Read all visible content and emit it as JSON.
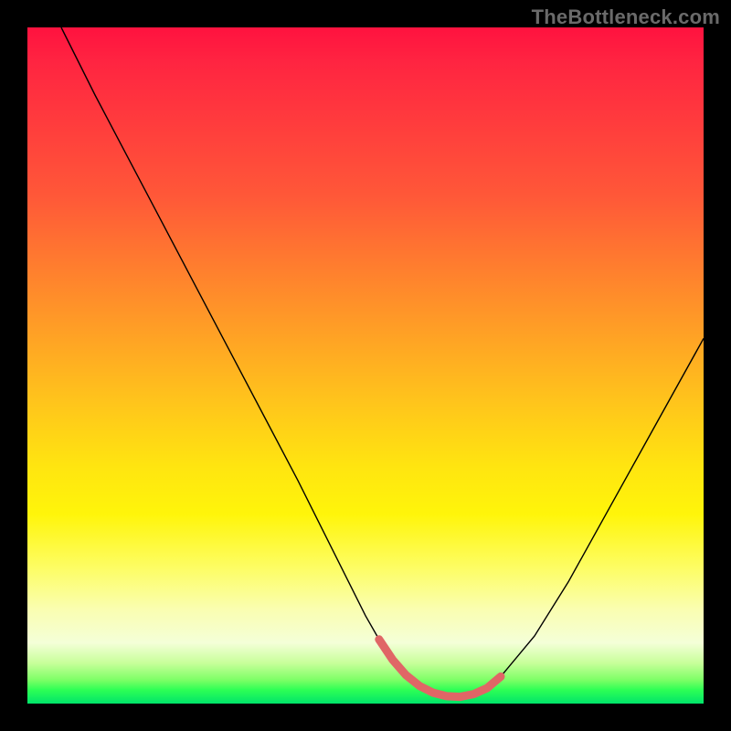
{
  "watermark": "TheBottleneck.com",
  "chart_data": {
    "type": "line",
    "title": "",
    "xlabel": "",
    "ylabel": "",
    "xlim": [
      0,
      100
    ],
    "ylim": [
      0,
      100
    ],
    "grid": false,
    "legend": false,
    "background_gradient": [
      "#ff123f",
      "#ff8e2a",
      "#ffe510",
      "#fafeb0",
      "#2dff55",
      "#00e36a"
    ],
    "series": [
      {
        "name": "bottleneck-curve",
        "color": "#000000",
        "stroke_width": 1.4,
        "x": [
          5,
          10,
          15,
          20,
          25,
          30,
          35,
          40,
          45,
          50,
          52,
          54,
          56,
          58,
          60,
          62,
          64,
          66,
          68,
          70,
          75,
          80,
          85,
          90,
          95,
          100
        ],
        "y": [
          100,
          90,
          80.5,
          71,
          61.5,
          52,
          42.5,
          33,
          23,
          13,
          9.5,
          6.5,
          4.2,
          2.6,
          1.6,
          1.1,
          1.0,
          1.4,
          2.3,
          4.0,
          10,
          18,
          27,
          36,
          45,
          54
        ]
      },
      {
        "name": "optimal-range-marker",
        "color": "#e06666",
        "stroke_width": 9,
        "linecap": "round",
        "x": [
          52,
          54,
          56,
          58,
          60,
          62,
          64,
          66,
          68,
          70
        ],
        "y": [
          9.5,
          6.5,
          4.2,
          2.6,
          1.6,
          1.1,
          1.0,
          1.4,
          2.3,
          4.0
        ]
      }
    ]
  }
}
